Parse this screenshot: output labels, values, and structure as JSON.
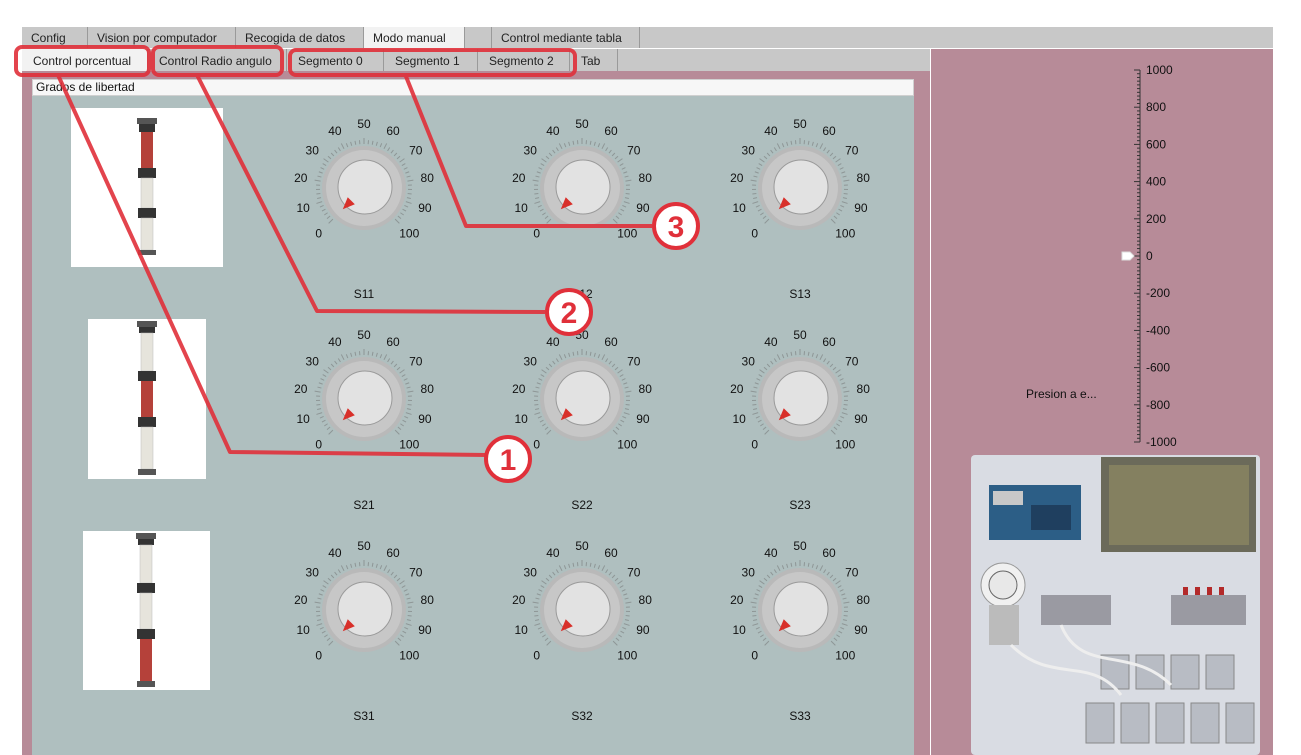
{
  "top_tabs": [
    {
      "label": "Config",
      "active": false
    },
    {
      "label": "Vision por computador",
      "active": false
    },
    {
      "label": "Recogida de datos",
      "active": false
    },
    {
      "label": "Modo manual",
      "active": true
    },
    {
      "label": "",
      "active": false
    },
    {
      "label": "Control mediante tabla",
      "active": false
    }
  ],
  "sub_tabs": [
    {
      "label": "Control porcentual",
      "active": true
    },
    {
      "label": "Control Radio angulo",
      "active": false
    },
    {
      "label": "Segmento 0",
      "active": false
    },
    {
      "label": "Segmento 1",
      "active": false
    },
    {
      "label": "Segmento 2",
      "active": false
    },
    {
      "label": "Tab",
      "active": false
    }
  ],
  "group_title": "Grados de libertad",
  "knob_scale": [
    "0",
    "10",
    "20",
    "30",
    "40",
    "50",
    "60",
    "70",
    "80",
    "90",
    "100"
  ],
  "knobs": [
    {
      "label": "S11",
      "value": 0
    },
    {
      "label": "S12",
      "value": 0
    },
    {
      "label": "S13",
      "value": 0
    },
    {
      "label": "S21",
      "value": 0
    },
    {
      "label": "S22",
      "value": 0
    },
    {
      "label": "S23",
      "value": 0
    },
    {
      "label": "S31",
      "value": 0
    },
    {
      "label": "S32",
      "value": 0
    },
    {
      "label": "S33",
      "value": 0
    }
  ],
  "robot_segments": [
    {
      "red_section": "top"
    },
    {
      "red_section": "middle"
    },
    {
      "red_section": "bottom"
    }
  ],
  "slider": {
    "ticks": [
      "1000",
      "800",
      "600",
      "400",
      "200",
      "0",
      "-200",
      "-400",
      "-600",
      "-800",
      "-1000"
    ],
    "value": 0,
    "min": -1000,
    "max": 1000
  },
  "press_label": "Presion a e...",
  "annotations": [
    {
      "number": "1",
      "target": "Control porcentual"
    },
    {
      "number": "2",
      "target": "Control Radio angulo"
    },
    {
      "number": "3",
      "target": "Segmento 0 / Segmento 1 / Segmento 2"
    }
  ],
  "colors": {
    "panel": "#b78b98",
    "group_body": "#afbfbf",
    "annotation_red": "#e0303a",
    "robot_red": "#b5413a"
  }
}
